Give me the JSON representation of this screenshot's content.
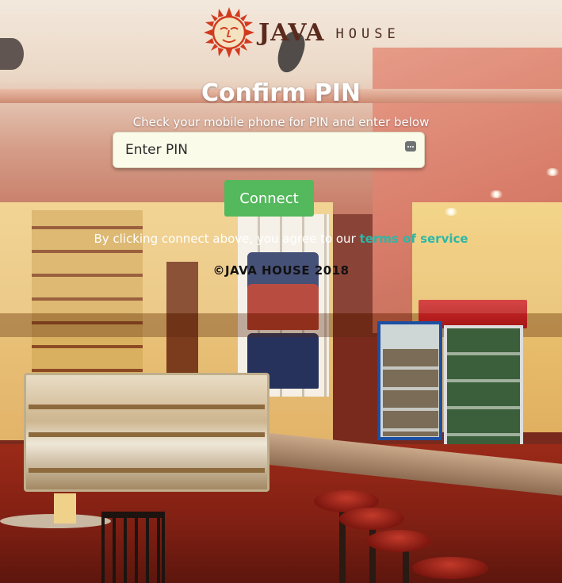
{
  "brand": {
    "logo_icon": "sun-face-icon",
    "name_primary": "JAVA",
    "name_secondary": "HOUSE",
    "color": "#5a2a1c"
  },
  "form": {
    "title": "Confirm PIN",
    "subtitle": "Check your mobile phone for PIN and enter below",
    "pin_input": {
      "value": "",
      "placeholder": "Enter PIN",
      "icon": "password-dots-icon"
    },
    "connect_label": "Connect",
    "connect_color": "#54b85c"
  },
  "terms": {
    "text": "By clicking connect above, you agree to our ",
    "link_label": "terms of service",
    "link_color": "#2bb8a6"
  },
  "footer": {
    "copyright_symbol": "©",
    "copyright_text": "JAVA HOUSE 2018"
  }
}
